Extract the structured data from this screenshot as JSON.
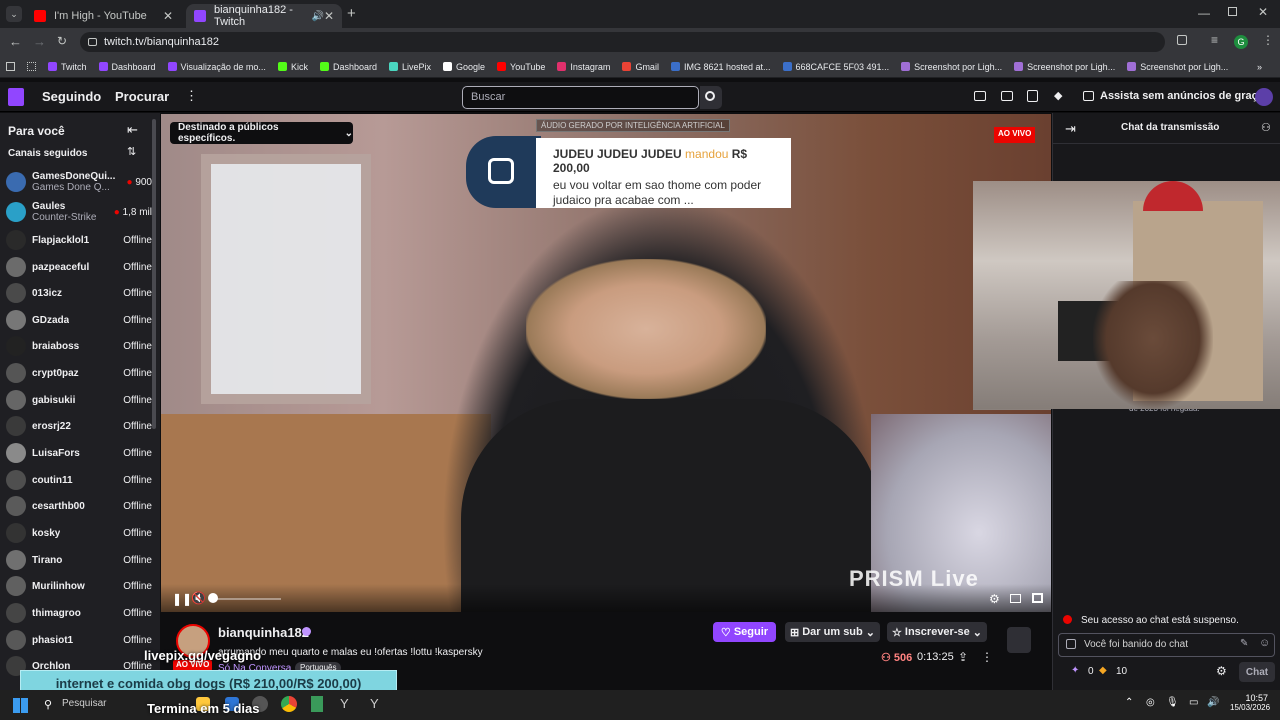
{
  "browser": {
    "tabs": [
      {
        "title": "I'm High - YouTube",
        "color": "#ff0000"
      },
      {
        "title": "bianquinha182 - Twitch",
        "color": "#9146ff"
      }
    ],
    "url": "twitch.tv/bianquinha182",
    "bookmarks": [
      {
        "label": "Twitch",
        "color": "#9146ff"
      },
      {
        "label": "Dashboard",
        "color": "#9146ff"
      },
      {
        "label": "Visualização de mo...",
        "color": "#9146ff"
      },
      {
        "label": "Kick",
        "color": "#53fc18"
      },
      {
        "label": "Dashboard",
        "color": "#53fc18"
      },
      {
        "label": "LivePix",
        "color": "#4ad6c0"
      },
      {
        "label": "Google",
        "color": "#ffffff"
      },
      {
        "label": "YouTube",
        "color": "#ff0000"
      },
      {
        "label": "Instagram",
        "color": "#e1306c"
      },
      {
        "label": "Gmail",
        "color": "#ea4335"
      },
      {
        "label": "IMG 8621 hosted at...",
        "color": "#3b6fc9"
      },
      {
        "label": "668CAFCE 5F03 491...",
        "color": "#3b6fc9"
      },
      {
        "label": "Screenshot por Ligh...",
        "color": "#a06fd6"
      },
      {
        "label": "Screenshot por Ligh...",
        "color": "#a06fd6"
      },
      {
        "label": "Screenshot por Ligh...",
        "color": "#a06fd6"
      }
    ]
  },
  "header": {
    "following": "Seguindo",
    "browse": "Procurar",
    "search_placeholder": "Buscar",
    "ad_free": "Assista sem anúncios de graça"
  },
  "sidebar": {
    "for_you": "Para você",
    "followed": "Canais seguidos",
    "channels": [
      {
        "name": "GamesDoneQui...",
        "sub": "Games Done Q...",
        "status": "900",
        "live": true
      },
      {
        "name": "Gaules",
        "sub": "Counter-Strike",
        "status": "1,8 mil",
        "live": true
      },
      {
        "name": "Flapjacklol1",
        "status": "Offline"
      },
      {
        "name": "pazpeaceful",
        "status": "Offline"
      },
      {
        "name": "013icz",
        "status": "Offline"
      },
      {
        "name": "GDzada",
        "status": "Offline"
      },
      {
        "name": "braiaboss",
        "status": "Offline"
      },
      {
        "name": "crypt0paz",
        "status": "Offline"
      },
      {
        "name": "gabisukii",
        "status": "Offline"
      },
      {
        "name": "erosrj22",
        "status": "Offline"
      },
      {
        "name": "LuisaFors",
        "status": "Offline"
      },
      {
        "name": "coutin11",
        "status": "Offline"
      },
      {
        "name": "cesarthb00",
        "status": "Offline"
      },
      {
        "name": "kosky",
        "status": "Offline"
      },
      {
        "name": "Tirano",
        "status": "Offline"
      },
      {
        "name": "Murilinhow",
        "status": "Offline"
      },
      {
        "name": "thimagroo",
        "status": "Offline"
      },
      {
        "name": "phasiot1",
        "status": "Offline"
      },
      {
        "name": "Orchlon",
        "status": "Offline"
      }
    ]
  },
  "player": {
    "audience": "Destinado a públicos específicos.",
    "ai_label": "ÁUDIO GERADO POR INTELIGÊNCIA ARTIFICIAL",
    "live": "AO VIVO",
    "alert_user": "JUDEU JUDEU JUDEU",
    "alert_sent": "mandou",
    "alert_amount": "R$ 200,00",
    "alert_msg": "eu vou voltar em sao thome com poder judaico pra acabae com ...",
    "watermark": "PRISM Live",
    "cam_caption": "de 2023 foi negada."
  },
  "stream": {
    "channel": "bianquinha182",
    "title": "arrumando meu quarto e malas eu !ofertas !lottu !kaspersky",
    "live_badge": "AO VIVO",
    "category": "Só Na Conversa",
    "language": "Português",
    "follow": "Seguir",
    "gift_sub": "Dar um sub",
    "subscribe": "Inscrever-se",
    "viewers": "506",
    "uptime": "0:13:25"
  },
  "chat": {
    "title": "Chat da transmissão",
    "suspended": "Seu acesso ao chat está suspenso.",
    "banned": "Você foi banido do chat",
    "points": "0",
    "bits": "10",
    "chat_button": "Chat"
  },
  "overlay": {
    "livepix": "livepix.gg/vegagno",
    "goal": "internet e comida obg dogs (R$ 210,00/R$ 200,00)",
    "ends": "Termina em 5 dias"
  },
  "taskbar": {
    "search": "Pesquisar",
    "time": "10:57",
    "date": "15/03/2026"
  }
}
